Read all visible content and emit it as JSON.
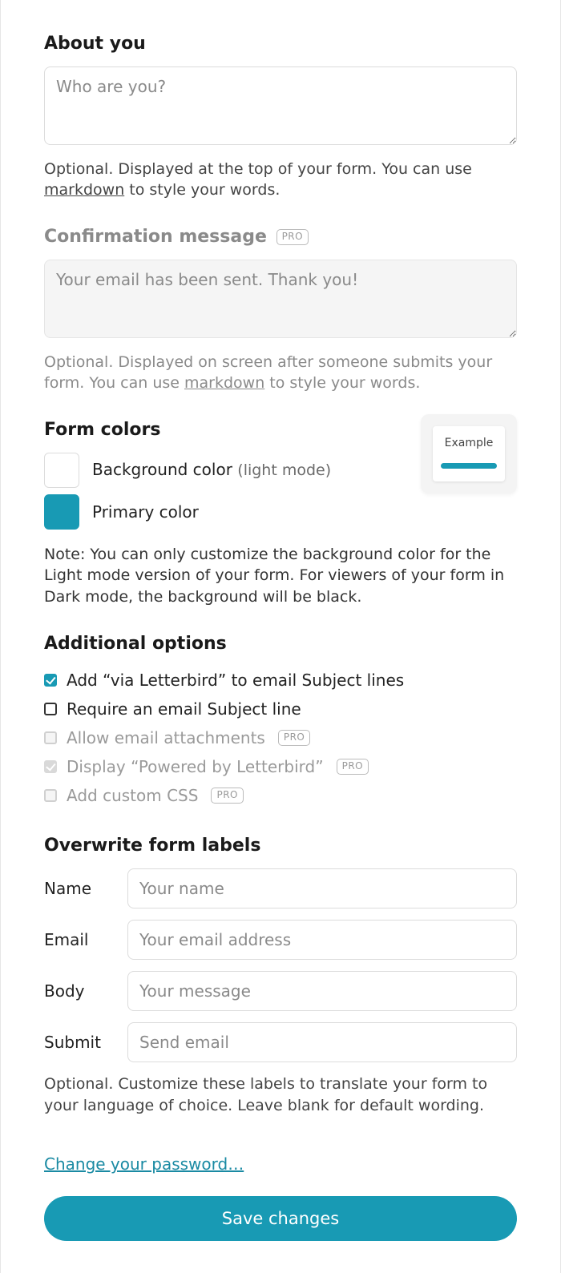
{
  "about": {
    "title": "About you",
    "placeholder": "Who are you?",
    "help_prefix": "Optional. Displayed at the top of your form. You can use ",
    "help_link": "markdown",
    "help_suffix": " to style your words."
  },
  "confirmation": {
    "title": "Confirmation message",
    "pro_badge": "PRO",
    "placeholder": "Your email has been sent. Thank you!",
    "help_prefix": "Optional. Displayed on screen after someone submits your form. You can use ",
    "help_link": "markdown",
    "help_suffix": " to style your words."
  },
  "colors": {
    "title": "Form colors",
    "bg_label": "Background color",
    "bg_sub": "(light mode)",
    "primary_label": "Primary color",
    "bg_hex": "#ffffff",
    "primary_hex": "#189ab4",
    "preview_text": "Example",
    "note": "Note: You can only customize the background color for the Light mode version of your form. For viewers of your form in Dark mode, the background will be black."
  },
  "options": {
    "title": "Additional options",
    "pro_badge": "PRO",
    "items": [
      {
        "label": "Add “via Letterbird” to email Subject lines",
        "checked": true,
        "disabled": false,
        "pro": false
      },
      {
        "label": "Require an email Subject line",
        "checked": false,
        "disabled": false,
        "pro": false
      },
      {
        "label": "Allow email attachments",
        "checked": false,
        "disabled": true,
        "pro": true
      },
      {
        "label": "Display “Powered by Letterbird”",
        "checked": true,
        "disabled": true,
        "pro": true
      },
      {
        "label": "Add custom CSS",
        "checked": false,
        "disabled": true,
        "pro": true
      }
    ]
  },
  "labels": {
    "title": "Overwrite form labels",
    "rows": [
      {
        "name": "Name",
        "placeholder": "Your name"
      },
      {
        "name": "Email",
        "placeholder": "Your email address"
      },
      {
        "name": "Body",
        "placeholder": "Your message"
      },
      {
        "name": "Submit",
        "placeholder": "Send email"
      }
    ],
    "help": "Optional. Customize these labels to translate your form to your language of choice. Leave blank for default wording."
  },
  "password_link": "Change your password…",
  "save_button": "Save changes"
}
